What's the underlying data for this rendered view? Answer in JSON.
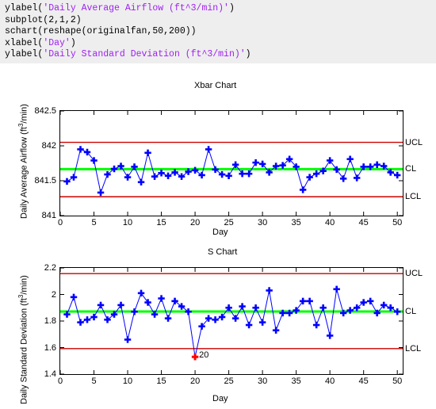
{
  "code": {
    "lines": [
      [
        {
          "t": "ylabel(",
          "c": "k"
        },
        {
          "t": "'Daily Average Airflow (ft^3/min)'",
          "c": "s"
        },
        {
          "t": ")",
          "c": "k"
        }
      ],
      [
        {
          "t": "subplot(2,1,2)",
          "c": "k"
        }
      ],
      [
        {
          "t": "schart(reshape(originalfan,50,200))",
          "c": "k"
        }
      ],
      [
        {
          "t": "xlabel(",
          "c": "k"
        },
        {
          "t": "'Day'",
          "c": "s"
        },
        {
          "t": ")",
          "c": "k"
        }
      ],
      [
        {
          "t": "ylabel(",
          "c": "k"
        },
        {
          "t": "'Daily Standard Deviation (ft^3/min)'",
          "c": "s"
        },
        {
          "t": ")",
          "c": "k"
        }
      ]
    ],
    "background": "#eeeeee",
    "string_color": "#a020f0",
    "keyword_color": "#000000"
  },
  "colors": {
    "data_line": "#0000ff",
    "marker": "#0000ff",
    "center_line": "#00ff00",
    "control_limit": "#cc0000",
    "violation": "#ff0000",
    "axis": "#000000"
  },
  "chart_data": [
    {
      "type": "line",
      "name": "xbar-chart",
      "title": "Xbar Chart",
      "xlabel": "Day",
      "ylabel": "Daily Average Airflow (ft^3/min)",
      "ylabel_unit_sup": "3",
      "xlim": [
        0,
        50.8
      ],
      "ylim": [
        841,
        842.5
      ],
      "xticks": [
        0,
        5,
        10,
        15,
        20,
        25,
        30,
        35,
        40,
        45,
        50
      ],
      "xticklabels": [
        "0",
        "5",
        "10",
        "15",
        "20",
        "25",
        "30",
        "35",
        "40",
        "45",
        "50"
      ],
      "yticks": [
        841,
        841.5,
        842,
        842.5
      ],
      "yticklabels": [
        "841",
        "841.5",
        "842",
        "842.5"
      ],
      "grid": false,
      "center_line": 841.666,
      "center_line_label": "CL",
      "upper_control_limit": 842.05,
      "upper_control_limit_label": "UCL",
      "lower_control_limit": 841.27,
      "lower_control_limit_label": "LCL",
      "x": [
        1,
        2,
        3,
        4,
        5,
        6,
        7,
        8,
        9,
        10,
        11,
        12,
        13,
        14,
        15,
        16,
        17,
        18,
        19,
        20,
        21,
        22,
        23,
        24,
        25,
        26,
        27,
        28,
        29,
        30,
        31,
        32,
        33,
        34,
        35,
        36,
        37,
        38,
        39,
        40,
        41,
        42,
        43,
        44,
        45,
        46,
        47,
        48,
        49,
        50
      ],
      "values": [
        841.49,
        841.55,
        841.95,
        841.91,
        841.79,
        841.33,
        841.59,
        841.67,
        841.71,
        841.55,
        841.7,
        841.48,
        841.9,
        841.56,
        841.61,
        841.57,
        841.62,
        841.56,
        841.63,
        841.65,
        841.58,
        841.95,
        841.66,
        841.59,
        841.57,
        841.73,
        841.6,
        841.6,
        841.76,
        841.74,
        841.62,
        841.71,
        841.72,
        841.81,
        841.7,
        841.37,
        841.55,
        841.6,
        841.64,
        841.79,
        841.66,
        841.53,
        841.81,
        841.54,
        841.7,
        841.7,
        841.73,
        841.71,
        841.62,
        841.58
      ],
      "violations": []
    },
    {
      "type": "line",
      "name": "s-chart",
      "title": "S Chart",
      "xlabel": "Day",
      "ylabel": "Daily Standard Deviation (ft^3/min)",
      "ylabel_unit_sup": "3",
      "xlim": [
        0,
        50.8
      ],
      "ylim": [
        1.4,
        2.2
      ],
      "xticks": [
        0,
        5,
        10,
        15,
        20,
        25,
        30,
        35,
        40,
        45,
        50
      ],
      "xticklabels": [
        "0",
        "5",
        "10",
        "15",
        "20",
        "25",
        "30",
        "35",
        "40",
        "45",
        "50"
      ],
      "yticks": [
        1.4,
        1.6,
        1.8,
        2.0,
        2.2
      ],
      "yticklabels": [
        "1.4",
        "1.6",
        "1.8",
        "2",
        "2.2"
      ],
      "grid": false,
      "center_line": 1.872,
      "center_line_label": "CL",
      "upper_control_limit": 2.157,
      "upper_control_limit_label": "UCL",
      "lower_control_limit": 1.592,
      "lower_control_limit_label": "LCL",
      "x": [
        1,
        2,
        3,
        4,
        5,
        6,
        7,
        8,
        9,
        10,
        11,
        12,
        13,
        14,
        15,
        16,
        17,
        18,
        19,
        20,
        21,
        22,
        23,
        24,
        25,
        26,
        27,
        28,
        29,
        30,
        31,
        32,
        33,
        34,
        35,
        36,
        37,
        38,
        39,
        40,
        41,
        42,
        43,
        44,
        45,
        46,
        47,
        48,
        49,
        50
      ],
      "values": [
        1.85,
        1.98,
        1.79,
        1.81,
        1.83,
        1.92,
        1.81,
        1.85,
        1.92,
        1.66,
        1.87,
        2.01,
        1.94,
        1.85,
        1.97,
        1.82,
        1.95,
        1.91,
        1.87,
        1.53,
        1.76,
        1.82,
        1.81,
        1.83,
        1.9,
        1.82,
        1.91,
        1.77,
        1.9,
        1.79,
        2.03,
        1.73,
        1.86,
        1.86,
        1.88,
        1.95,
        1.95,
        1.77,
        1.9,
        1.69,
        2.04,
        1.86,
        1.88,
        1.9,
        1.94,
        1.95,
        1.86,
        1.92,
        1.9,
        1.87
      ],
      "violations": [
        {
          "x": 20,
          "y": 1.53,
          "label": "20"
        }
      ]
    }
  ]
}
